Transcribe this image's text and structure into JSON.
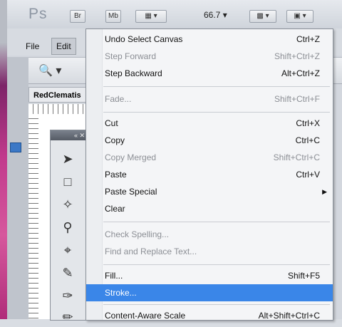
{
  "app": {
    "logo": "Ps",
    "buttons": {
      "bridge": "Br",
      "mini_bridge": "Mb"
    },
    "zoom": "66.7",
    "menus": [
      "File",
      "Edit"
    ],
    "document_tab": "RedClematis"
  },
  "tools_panel": {
    "header": "« ✕"
  },
  "edit_menu": {
    "items": [
      {
        "label": "Undo Select Canvas",
        "shortcut": "Ctrl+Z",
        "enabled": true
      },
      {
        "label": "Step Forward",
        "shortcut": "Shift+Ctrl+Z",
        "enabled": false
      },
      {
        "label": "Step Backward",
        "shortcut": "Alt+Ctrl+Z",
        "enabled": true
      },
      {
        "label": "Fade...",
        "shortcut": "Shift+Ctrl+F",
        "enabled": false
      },
      {
        "label": "Cut",
        "shortcut": "Ctrl+X",
        "enabled": true
      },
      {
        "label": "Copy",
        "shortcut": "Ctrl+C",
        "enabled": true
      },
      {
        "label": "Copy Merged",
        "shortcut": "Shift+Ctrl+C",
        "enabled": false
      },
      {
        "label": "Paste",
        "shortcut": "Ctrl+V",
        "enabled": true
      },
      {
        "label": "Paste Special",
        "shortcut": "",
        "enabled": true
      },
      {
        "label": "Clear",
        "shortcut": "",
        "enabled": true
      },
      {
        "label": "Check Spelling...",
        "shortcut": "",
        "enabled": false
      },
      {
        "label": "Find and Replace Text...",
        "shortcut": "",
        "enabled": false
      },
      {
        "label": "Fill...",
        "shortcut": "Shift+F5",
        "enabled": true
      },
      {
        "label": "Stroke...",
        "shortcut": "",
        "enabled": true,
        "highlighted": true
      },
      {
        "label": "Content-Aware Scale",
        "shortcut": "Alt+Shift+Ctrl+C",
        "enabled": true
      }
    ]
  },
  "colors": {
    "highlight": "#3a86e8",
    "disabled_text": "#8c8f95"
  }
}
